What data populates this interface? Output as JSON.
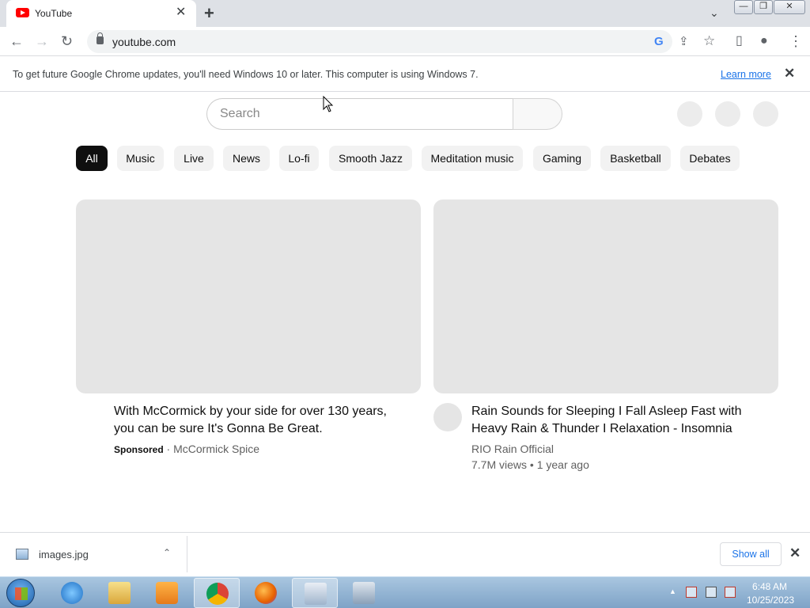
{
  "browser": {
    "tab": {
      "title": "YouTube",
      "close": "✕"
    },
    "new_tab": "+",
    "tab_search": "⌄",
    "window_controls": {
      "minimize": "—",
      "restore": "❐",
      "close": "✕"
    },
    "nav": {
      "back": "←",
      "forward": "→",
      "reload": "↻"
    },
    "address": "youtube.com",
    "google_icon": "G",
    "share_icon": "⇪",
    "bookmark_icon": "☆",
    "sidepanel_icon": "▯",
    "profile_icon": "●",
    "menu_icon": "⋮"
  },
  "infobar": {
    "message": "To get future Google Chrome updates, you'll need Windows 10 or later. This computer is using Windows 7.",
    "link": "Learn more",
    "close": "✕"
  },
  "youtube": {
    "search_placeholder": "Search",
    "chips": [
      "All",
      "Music",
      "Live",
      "News",
      "Lo-fi",
      "Smooth Jazz",
      "Meditation music",
      "Gaming",
      "Basketball",
      "Debates"
    ],
    "videos": [
      {
        "title": "With McCormick by your side for over 130 years, you can be sure It's Gonna Be Great.",
        "sponsored": "Sponsored",
        "separator": " · ",
        "channel": "McCormick Spice"
      },
      {
        "title": "Rain Sounds for Sleeping I Fall Asleep Fast with Heavy Rain & Thunder I Relaxation - Insomnia",
        "channel": "RIO Rain Official",
        "stats": "7.7M views • 1 year ago"
      }
    ]
  },
  "downloads": {
    "file": "images.jpg",
    "caret": "⌃",
    "show_all": "Show all",
    "close": "✕"
  },
  "taskbar": {
    "time": "6:48 AM",
    "date": "10/25/2023",
    "tray_arrow": "▲"
  }
}
